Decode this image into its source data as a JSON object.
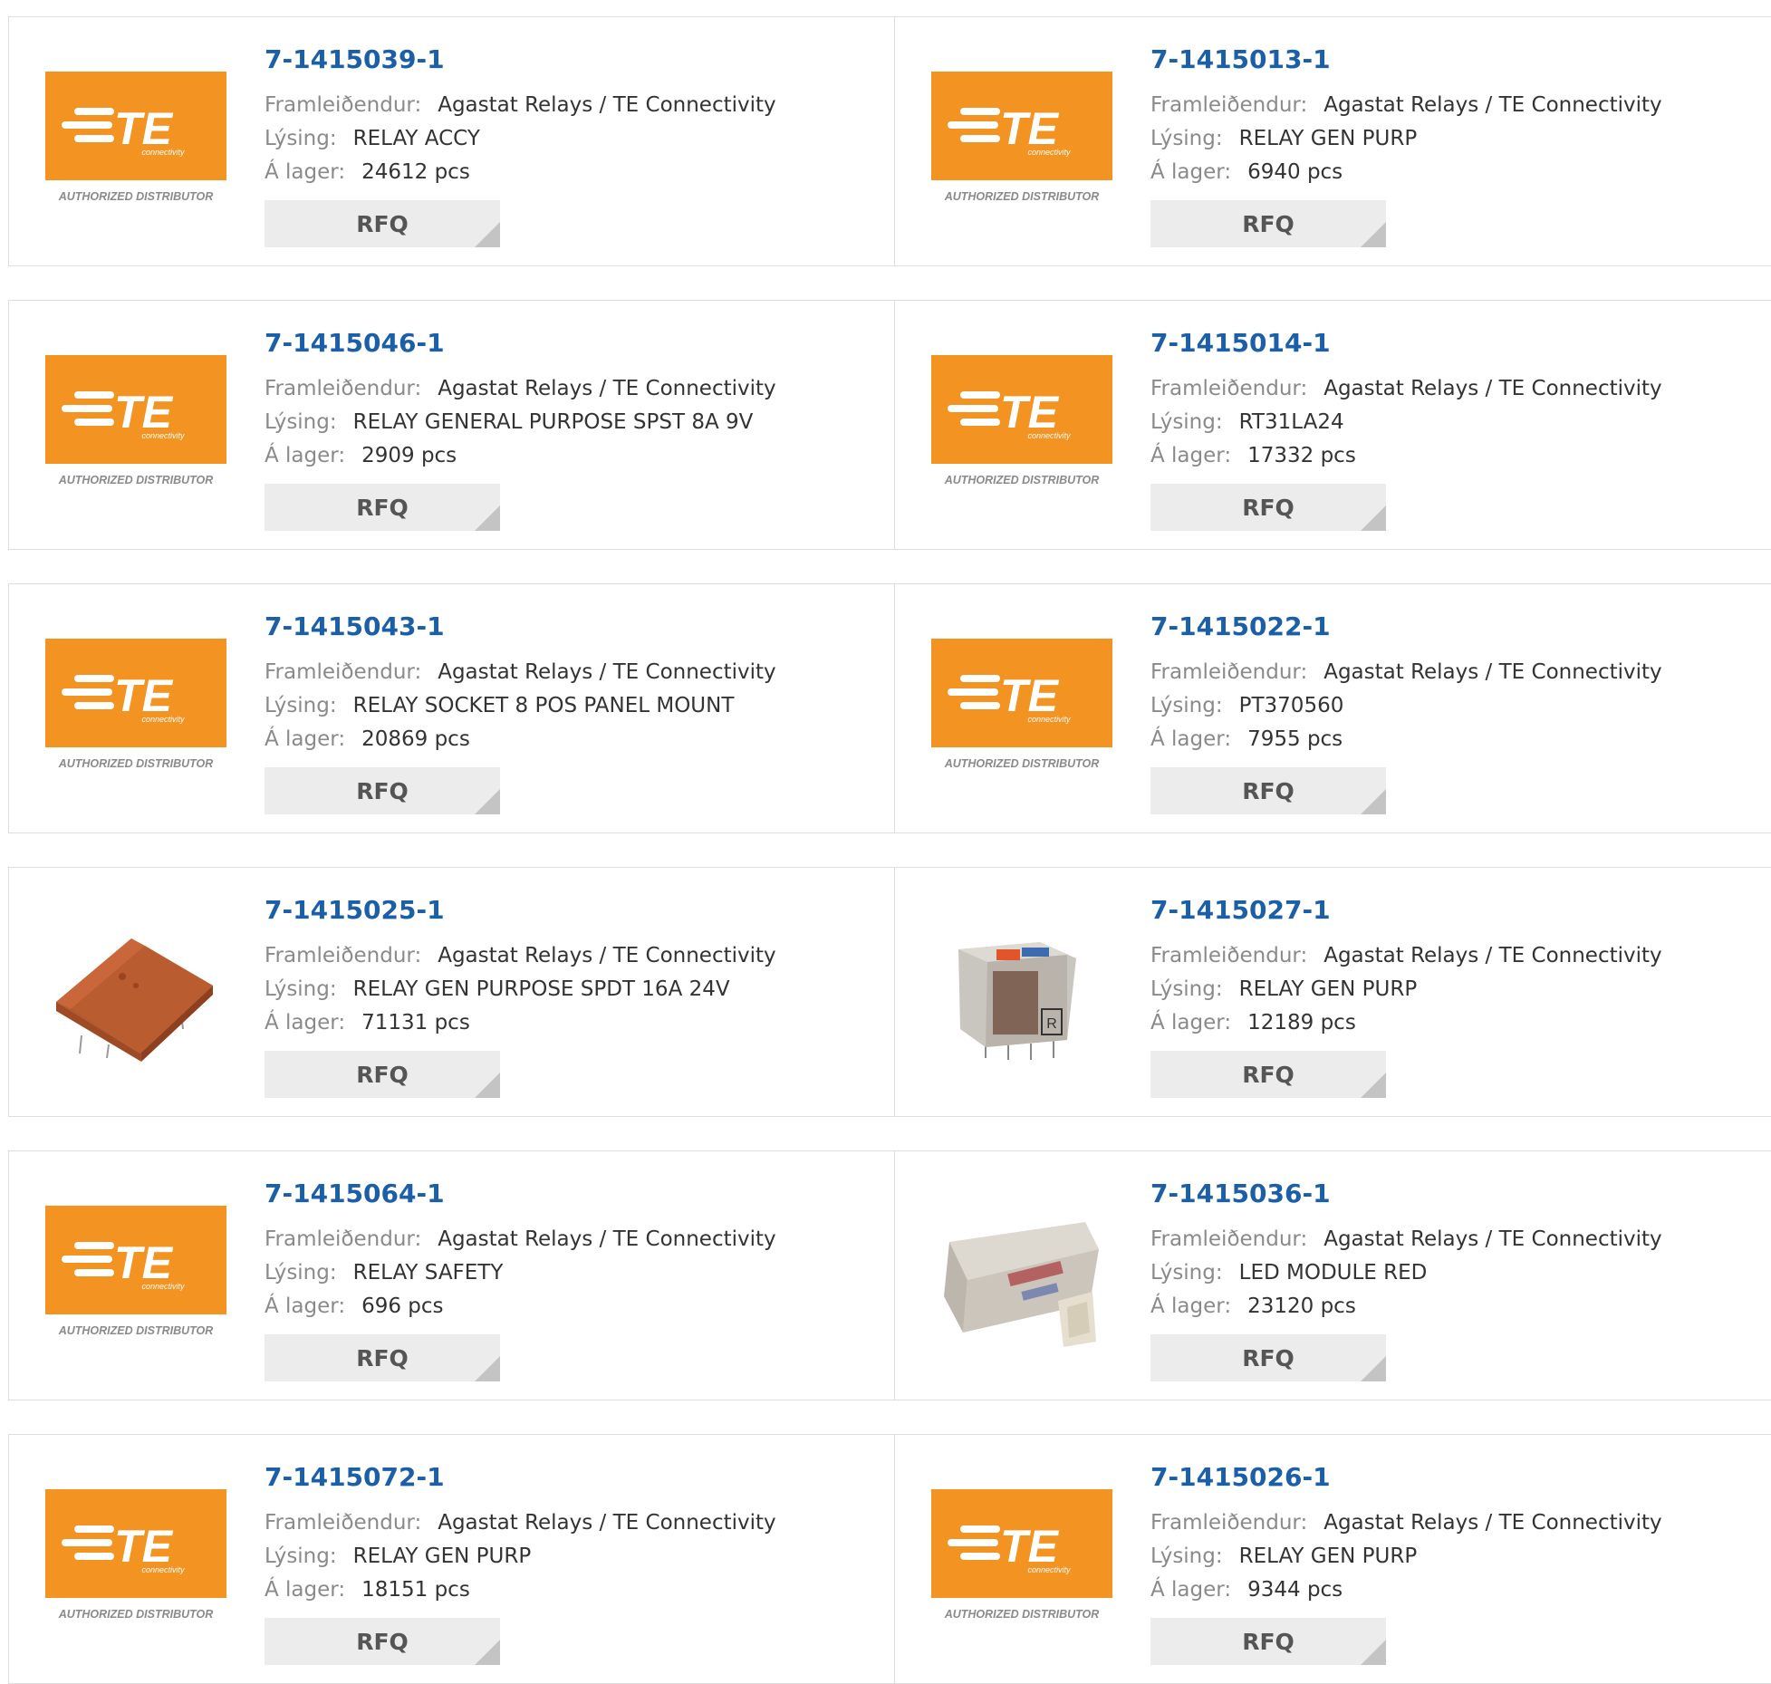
{
  "labels": {
    "manufacturer": "Framleiðendur:",
    "description": "Lýsing:",
    "stock": "Á lager:",
    "rfq": "RFQ"
  },
  "logo": {
    "brand_text": "TE",
    "sub_text": "connectivity",
    "tagline": "AUTHORIZED DISTRIBUTOR",
    "brand_color": "#f39322"
  },
  "colors": {
    "part_number": "#1a5fa8",
    "label": "#8a8a8a",
    "value": "#333333",
    "rfq_bg": "#ececec"
  },
  "products": [
    {
      "part_number": "7-1415039-1",
      "manufacturer": "Agastat Relays / TE Connectivity",
      "description": "RELAY ACCY",
      "stock": "24612 pcs",
      "image": "te-logo"
    },
    {
      "part_number": "7-1415013-1",
      "manufacturer": "Agastat Relays / TE Connectivity",
      "description": "RELAY GEN PURP",
      "stock": "6940 pcs",
      "image": "te-logo"
    },
    {
      "part_number": "7-1415046-1",
      "manufacturer": "Agastat Relays / TE Connectivity",
      "description": "RELAY GENERAL PURPOSE SPST 8A 9V",
      "stock": "2909 pcs",
      "image": "te-logo"
    },
    {
      "part_number": "7-1415014-1",
      "manufacturer": "Agastat Relays / TE Connectivity",
      "description": "RT31LA24",
      "stock": "17332 pcs",
      "image": "te-logo"
    },
    {
      "part_number": "7-1415043-1",
      "manufacturer": "Agastat Relays / TE Connectivity",
      "description": "RELAY SOCKET 8 POS PANEL MOUNT",
      "stock": "20869 pcs",
      "image": "te-logo"
    },
    {
      "part_number": "7-1415022-1",
      "manufacturer": "Agastat Relays / TE Connectivity",
      "description": "PT370560",
      "stock": "7955 pcs",
      "image": "te-logo"
    },
    {
      "part_number": "7-1415025-1",
      "manufacturer": "Agastat Relays / TE Connectivity",
      "description": "RELAY GEN PURPOSE SPDT 16A 24V",
      "stock": "71131 pcs",
      "image": "relay-red-photo"
    },
    {
      "part_number": "7-1415027-1",
      "manufacturer": "Agastat Relays / TE Connectivity",
      "description": "RELAY GEN PURP",
      "stock": "12189 pcs",
      "image": "relay-clear-photo"
    },
    {
      "part_number": "7-1415064-1",
      "manufacturer": "Agastat Relays / TE Connectivity",
      "description": "RELAY SAFETY",
      "stock": "696 pcs",
      "image": "te-logo"
    },
    {
      "part_number": "7-1415036-1",
      "manufacturer": "Agastat Relays / TE Connectivity",
      "description": "LED MODULE RED",
      "stock": "23120 pcs",
      "image": "led-module-photo"
    },
    {
      "part_number": "7-1415072-1",
      "manufacturer": "Agastat Relays / TE Connectivity",
      "description": "RELAY GEN PURP",
      "stock": "18151 pcs",
      "image": "te-logo"
    },
    {
      "part_number": "7-1415026-1",
      "manufacturer": "Agastat Relays / TE Connectivity",
      "description": "RELAY GEN PURP",
      "stock": "9344 pcs",
      "image": "te-logo"
    }
  ]
}
